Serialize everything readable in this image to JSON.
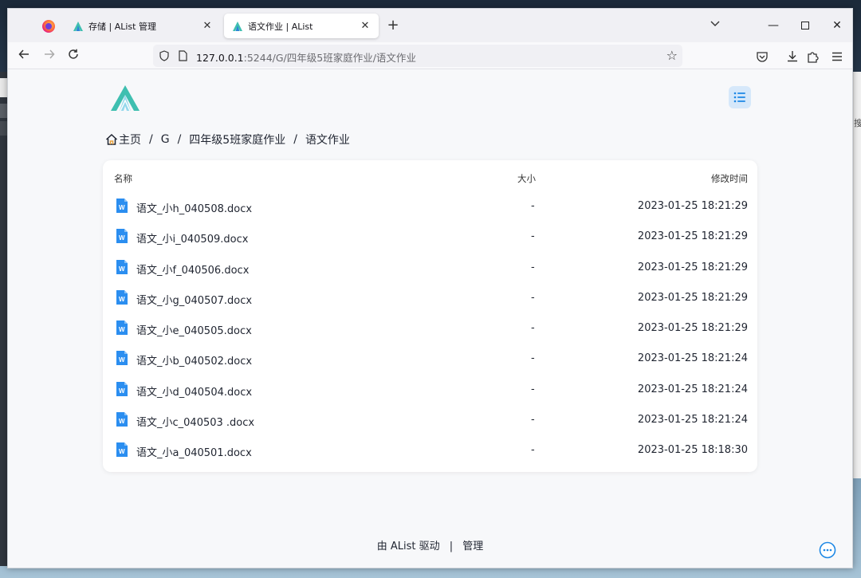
{
  "browser": {
    "tabs": [
      {
        "title": "存储 | AList 管理",
        "active": false
      },
      {
        "title": "语文作业 | AList",
        "active": true
      }
    ],
    "url_host": "127.0.0.1",
    "url_rest": ":5244/G/四年级5班家庭作业/语文作业"
  },
  "desktop": {
    "right_fragment_text": "搜"
  },
  "page": {
    "breadcrumb": [
      "主页",
      "G",
      "四年级5班家庭作业",
      "语文作业"
    ],
    "table_headers": {
      "name": "名称",
      "size": "大小",
      "modified": "修改时间"
    },
    "files": [
      {
        "name": "语文_小h_040508.docx",
        "size": "-",
        "modified": "2023-01-25 18:21:29",
        "icon": "word-doc-icon"
      },
      {
        "name": "语文_小i_040509.docx",
        "size": "-",
        "modified": "2023-01-25 18:21:29",
        "icon": "word-doc-icon"
      },
      {
        "name": "语文_小f_040506.docx",
        "size": "-",
        "modified": "2023-01-25 18:21:29",
        "icon": "word-doc-icon"
      },
      {
        "name": "语文_小g_040507.docx",
        "size": "-",
        "modified": "2023-01-25 18:21:29",
        "icon": "word-doc-icon"
      },
      {
        "name": "语文_小e_040505.docx",
        "size": "-",
        "modified": "2023-01-25 18:21:29",
        "icon": "word-doc-icon"
      },
      {
        "name": "语文_小b_040502.docx",
        "size": "-",
        "modified": "2023-01-25 18:21:24",
        "icon": "word-doc-icon"
      },
      {
        "name": "语文_小d_040504.docx",
        "size": "-",
        "modified": "2023-01-25 18:21:24",
        "icon": "word-doc-icon"
      },
      {
        "name": "语文_小c_040503 .docx",
        "size": "-",
        "modified": "2023-01-25 18:21:24",
        "icon": "word-doc-icon"
      },
      {
        "name": "语文_小a_040501.docx",
        "size": "-",
        "modified": "2023-01-25 18:18:30",
        "icon": "word-doc-icon"
      }
    ],
    "footer": {
      "powered_by": "由 AList 驱动",
      "separator": "|",
      "manage": "管理"
    }
  },
  "colors": {
    "accent": "#1e88e5",
    "logo_teal": "#3fbfb0",
    "toggle_bg": "#d6e8fa"
  }
}
